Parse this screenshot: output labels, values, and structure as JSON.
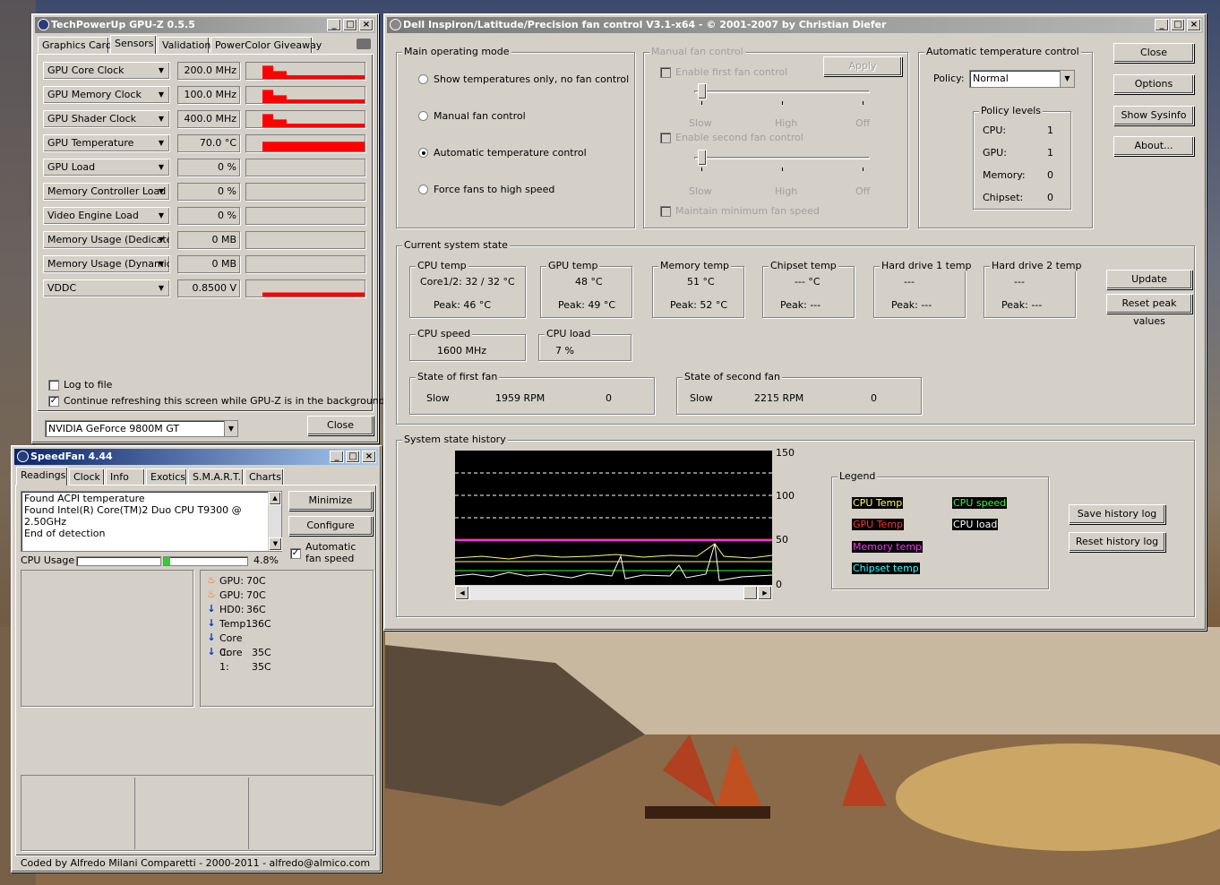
{
  "gpuz": {
    "title": "TechPowerUp GPU-Z 0.5.5",
    "tabs": [
      "Graphics Card",
      "Sensors",
      "Validation",
      "PowerColor Giveaway"
    ],
    "sensors": [
      {
        "name": "GPU Core Clock",
        "value": "200.0 MHz",
        "level": 0.7
      },
      {
        "name": "GPU Memory Clock",
        "value": "100.0 MHz",
        "level": 0.7
      },
      {
        "name": "GPU Shader Clock",
        "value": "400.0 MHz",
        "level": 0.7
      },
      {
        "name": "GPU Temperature",
        "value": "70.0 °C",
        "level": 0.6
      },
      {
        "name": "GPU Load",
        "value": "0 %",
        "level": 0
      },
      {
        "name": "Memory Controller Load",
        "value": "0 %",
        "level": 0
      },
      {
        "name": "Video Engine Load",
        "value": "0 %",
        "level": 0
      },
      {
        "name": "Memory Usage (Dedicated)",
        "value": "0 MB",
        "level": 0
      },
      {
        "name": "Memory Usage (Dynamic)",
        "value": "0 MB",
        "level": 0
      },
      {
        "name": "VDDC",
        "value": "0.8500 V",
        "level": 0.25
      }
    ],
    "log_to_file": "Log to file",
    "continue_refresh": "Continue refreshing this screen while GPU-Z is in the background",
    "gpu_select": "NVIDIA GeForce 9800M GT",
    "close": "Close"
  },
  "speedfan": {
    "title": "SpeedFan 4.44",
    "tabs": [
      "Readings",
      "Clock",
      "Info",
      "Exotics",
      "S.M.A.R.T.",
      "Charts"
    ],
    "log_lines": [
      "Found ACPI temperature",
      "Found Intel(R) Core(TM)2 Duo CPU T9300 @ 2.50GHz",
      "End of detection"
    ],
    "minimize": "Minimize",
    "configure": "Configure",
    "auto_fan": "Automatic fan speed",
    "cpu_usage_label": "CPU Usage",
    "cpu_usage_value": "4.8%",
    "cpu_usage_bars": [
      0.0,
      0.06
    ],
    "readings": [
      {
        "icon": "flame-icon",
        "label": "GPU:",
        "value": "70C"
      },
      {
        "icon": "flame-icon",
        "label": "GPU:",
        "value": "70C"
      },
      {
        "icon": "down-arrow-icon",
        "label": "HD0:",
        "value": "36C"
      },
      {
        "icon": "down-arrow-icon",
        "label": "Temp1:",
        "value": "36C"
      },
      {
        "icon": "down-arrow-icon",
        "label": "Core 0:",
        "value": "35C"
      },
      {
        "icon": "down-arrow-icon",
        "label": "Core 1:",
        "value": "35C"
      }
    ],
    "footer": "Coded by Alfredo Milani Comparetti - 2000-2011 - alfredo@almico.com"
  },
  "dell": {
    "title": "Dell Inspiron/Latitude/Precision fan control V3.1-x64 - © 2001-2007 by Christian Diefer",
    "main_mode": {
      "label": "Main operating mode",
      "options": [
        "Show temperatures only, no fan control",
        "Manual fan control",
        "Automatic temperature control",
        "Force fans to high speed"
      ],
      "selected": 2
    },
    "manual": {
      "label": "Manual fan control",
      "apply": "Apply",
      "enable_first": "Enable first fan control",
      "enable_second": "Enable second fan control",
      "ticks": [
        "Slow",
        "High",
        "Off"
      ],
      "maintain": "Maintain minimum fan speed"
    },
    "auto": {
      "label": "Automatic temperature control",
      "policy_label": "Policy:",
      "policy_value": "Normal",
      "levels_label": "Policy levels",
      "levels": [
        {
          "name": "CPU:",
          "value": "1"
        },
        {
          "name": "GPU:",
          "value": "1"
        },
        {
          "name": "Memory:",
          "value": "0"
        },
        {
          "name": "Chipset:",
          "value": "0"
        }
      ]
    },
    "buttons": {
      "close": "Close",
      "options": "Options",
      "sysinfo": "Show Sysinfo",
      "about": "About...",
      "update": "Update",
      "reset_peak": "Reset peak values",
      "save_history": "Save history log",
      "reset_history": "Reset history log"
    },
    "state": {
      "label": "Current system state",
      "temps": [
        {
          "label": "CPU temp",
          "value": "Core1/2: 32 / 32 °C",
          "peak": "Peak:  46 °C"
        },
        {
          "label": "GPU temp",
          "value": "48 °C",
          "peak": "Peak:  49 °C"
        },
        {
          "label": "Memory temp",
          "value": "51 °C",
          "peak": "Peak:  52 °C"
        },
        {
          "label": "Chipset temp",
          "value": "--- °C",
          "peak": "Peak:  ---"
        },
        {
          "label": "Hard drive 1 temp",
          "value": "---",
          "peak": "Peak:  ---"
        },
        {
          "label": "Hard drive 2 temp",
          "value": "---",
          "peak": "Peak:  ---"
        }
      ],
      "cpu_speed_label": "CPU speed",
      "cpu_speed": "1600 MHz",
      "cpu_load_label": "CPU load",
      "cpu_load": "7 %",
      "fan1_label": "State of first fan",
      "fan1": {
        "state": "Slow",
        "rpm": "1959 RPM",
        "num": "0"
      },
      "fan2_label": "State of second fan",
      "fan2": {
        "state": "Slow",
        "rpm": "2215 RPM",
        "num": "0"
      }
    },
    "history": {
      "label": "System state history",
      "y_ticks": [
        "150",
        "100",
        "50",
        "0"
      ],
      "legend_label": "Legend",
      "legend": [
        {
          "name": "CPU Temp",
          "color": "#ffff66"
        },
        {
          "name": "CPU speed",
          "color": "#33ff33"
        },
        {
          "name": "GPU Temp",
          "color": "#ff3333"
        },
        {
          "name": "CPU load",
          "color": "#ffffff"
        },
        {
          "name": "Memory temp",
          "color": "#ff33ff"
        },
        {
          "name": "Chipset temp",
          "color": "#33ffff"
        }
      ]
    }
  }
}
